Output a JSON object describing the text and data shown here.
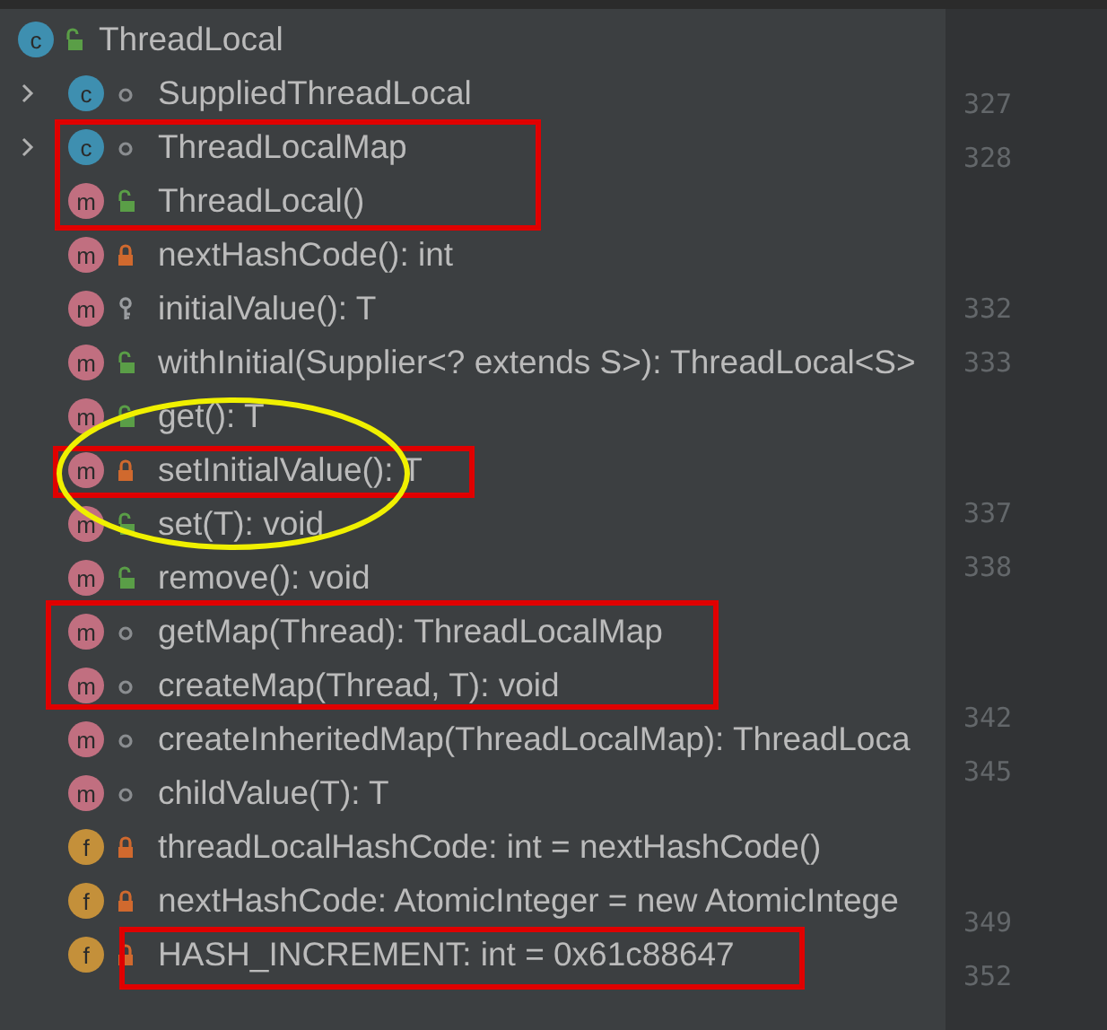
{
  "root": {
    "name": "ThreadLocal",
    "badge": {
      "kind": "class",
      "letter": "c"
    },
    "modifier": {
      "kind": "public"
    }
  },
  "members": [
    {
      "name": "SuppliedThreadLocal",
      "badge": {
        "kind": "class",
        "letter": "c"
      },
      "modifier": {
        "kind": "package"
      },
      "expandable": true,
      "expanded": false
    },
    {
      "name": "ThreadLocalMap",
      "badge": {
        "kind": "class",
        "letter": "c"
      },
      "modifier": {
        "kind": "package"
      },
      "expandable": true,
      "expanded": false
    },
    {
      "name": "ThreadLocal()",
      "badge": {
        "kind": "method",
        "letter": "m"
      },
      "modifier": {
        "kind": "public"
      },
      "expandable": false
    },
    {
      "name": "nextHashCode(): int",
      "badge": {
        "kind": "method",
        "letter": "m"
      },
      "modifier": {
        "kind": "private"
      },
      "expandable": false
    },
    {
      "name": "initialValue(): T",
      "badge": {
        "kind": "method",
        "letter": "m"
      },
      "modifier": {
        "kind": "protected"
      },
      "expandable": false
    },
    {
      "name": "withInitial(Supplier<? extends S>): ThreadLocal<S>",
      "badge": {
        "kind": "method",
        "letter": "m"
      },
      "modifier": {
        "kind": "public"
      },
      "expandable": false
    },
    {
      "name": "get(): T",
      "badge": {
        "kind": "method",
        "letter": "m"
      },
      "modifier": {
        "kind": "public"
      },
      "expandable": false
    },
    {
      "name": "setInitialValue(): T",
      "badge": {
        "kind": "method",
        "letter": "m"
      },
      "modifier": {
        "kind": "private"
      },
      "expandable": false
    },
    {
      "name": "set(T): void",
      "badge": {
        "kind": "method",
        "letter": "m"
      },
      "modifier": {
        "kind": "public"
      },
      "expandable": false
    },
    {
      "name": "remove(): void",
      "badge": {
        "kind": "method",
        "letter": "m"
      },
      "modifier": {
        "kind": "public"
      },
      "expandable": false
    },
    {
      "name": "getMap(Thread): ThreadLocalMap",
      "badge": {
        "kind": "method",
        "letter": "m"
      },
      "modifier": {
        "kind": "package"
      },
      "expandable": false
    },
    {
      "name": "createMap(Thread, T): void",
      "badge": {
        "kind": "method",
        "letter": "m"
      },
      "modifier": {
        "kind": "package"
      },
      "expandable": false
    },
    {
      "name": "createInheritedMap(ThreadLocalMap): ThreadLoca",
      "badge": {
        "kind": "method",
        "letter": "m"
      },
      "modifier": {
        "kind": "package"
      },
      "expandable": false
    },
    {
      "name": "childValue(T): T",
      "badge": {
        "kind": "method",
        "letter": "m"
      },
      "modifier": {
        "kind": "package"
      },
      "expandable": false
    },
    {
      "name": "threadLocalHashCode: int = nextHashCode()",
      "badge": {
        "kind": "field",
        "letter": "f"
      },
      "modifier": {
        "kind": "private"
      },
      "expandable": false
    },
    {
      "name": "nextHashCode: AtomicInteger = new AtomicIntege",
      "badge": {
        "kind": "field",
        "letter": "f"
      },
      "modifier": {
        "kind": "private"
      },
      "expandable": false
    },
    {
      "name": "HASH_INCREMENT: int = 0x61c88647",
      "badge": {
        "kind": "field",
        "letter": "f"
      },
      "modifier": {
        "kind": "private"
      },
      "expandable": false
    }
  ],
  "line_numbers": [
    "327",
    "328",
    "332",
    "333",
    "337",
    "338",
    "342",
    "345",
    "349",
    "352"
  ]
}
